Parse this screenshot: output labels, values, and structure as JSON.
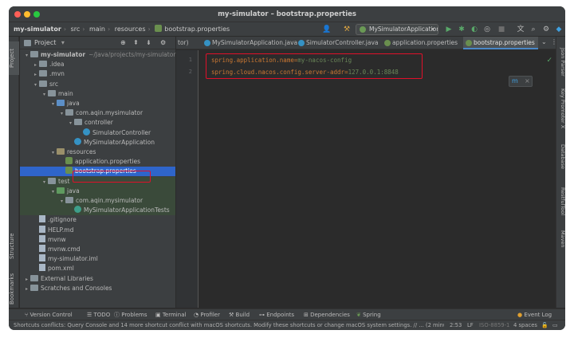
{
  "window": {
    "title": "my-simulator – bootstrap.properties"
  },
  "navbar": {
    "breadcrumbs": [
      "my-simulator",
      "src",
      "main",
      "resources",
      "bootstrap.properties"
    ],
    "run_config": "MySimulatorApplication"
  },
  "project_panel": {
    "title": "Project",
    "tree": [
      {
        "label": "my-simulator",
        "suffix": "~/Java/projects/my-simulator",
        "depth": 0,
        "expanded": true,
        "kind": "module"
      },
      {
        "label": ".idea",
        "depth": 1,
        "expanded": false,
        "kind": "folder"
      },
      {
        "label": ".mvn",
        "depth": 1,
        "expanded": false,
        "kind": "folder"
      },
      {
        "label": "src",
        "depth": 1,
        "expanded": true,
        "kind": "folder"
      },
      {
        "label": "main",
        "depth": 2,
        "expanded": true,
        "kind": "folder"
      },
      {
        "label": "java",
        "depth": 3,
        "expanded": true,
        "kind": "src"
      },
      {
        "label": "com.aqin.mysimulator",
        "depth": 4,
        "expanded": true,
        "kind": "package"
      },
      {
        "label": "controller",
        "depth": 5,
        "expanded": true,
        "kind": "package"
      },
      {
        "label": "SimulatorController",
        "depth": 6,
        "kind": "class"
      },
      {
        "label": "MySimulatorApplication",
        "depth": 5,
        "kind": "class"
      },
      {
        "label": "resources",
        "depth": 3,
        "expanded": true,
        "kind": "res"
      },
      {
        "label": "application.properties",
        "depth": 4,
        "kind": "props"
      },
      {
        "label": "bootstrap.properties",
        "depth": 4,
        "kind": "props",
        "selected": true
      },
      {
        "label": "test",
        "depth": 2,
        "expanded": true,
        "kind": "folder",
        "test": true
      },
      {
        "label": "java",
        "depth": 3,
        "expanded": true,
        "kind": "tst",
        "test": true
      },
      {
        "label": "com.aqin.mysimulator",
        "depth": 4,
        "expanded": true,
        "kind": "package",
        "test": true
      },
      {
        "label": "MySimulatorApplicationTests",
        "depth": 5,
        "kind": "class",
        "test": true
      },
      {
        "label": ".gitignore",
        "depth": 1,
        "kind": "file"
      },
      {
        "label": "HELP.md",
        "depth": 1,
        "kind": "file"
      },
      {
        "label": "mvnw",
        "depth": 1,
        "kind": "file"
      },
      {
        "label": "mvnw.cmd",
        "depth": 1,
        "kind": "file"
      },
      {
        "label": "my-simulator.iml",
        "depth": 1,
        "kind": "file"
      },
      {
        "label": "pom.xml",
        "depth": 1,
        "kind": "file"
      },
      {
        "label": "External Libraries",
        "depth": 0,
        "expanded": false,
        "kind": "lib"
      },
      {
        "label": "Scratches and Consoles",
        "depth": 0,
        "expanded": false,
        "kind": "lib"
      }
    ]
  },
  "editor": {
    "tabs": [
      {
        "label": "tor)",
        "active": false
      },
      {
        "label": "MySimulatorApplication.java",
        "active": false
      },
      {
        "label": "SimulatorController.java",
        "active": false
      },
      {
        "label": "application.properties",
        "active": false
      },
      {
        "label": "bootstrap.properties",
        "active": true
      }
    ],
    "lines": [
      {
        "num": "1",
        "key": "spring.application.name",
        "eq": "=",
        "value": "my-nacos-config"
      },
      {
        "num": "2",
        "key": "spring.cloud.nacos.config.server-addr",
        "eq": "=",
        "value": "127.0.0.1:8848"
      }
    ]
  },
  "left_stripe": {
    "top": [
      "Project"
    ],
    "bottom": [
      "Structure",
      "Bookmarks"
    ]
  },
  "right_stripe": [
    "Json Parser",
    "Key Promoter X",
    "Database",
    "RestfulTool",
    "Maven"
  ],
  "bottom_tools": [
    "Version Control",
    "TODO",
    "Problems",
    "Terminal",
    "Profiler",
    "Build",
    "Endpoints",
    "Dependencies",
    "Spring",
    "Event Log"
  ],
  "status_bar": {
    "message": "Shortcuts conflicts: Query Console and 14 more shortcut conflict with macOS shortcuts. Modify these shortcuts or change macOS system settings. // ... (2 minutes ago)",
    "position": "2:53",
    "line_sep": "LF",
    "encoding": "ISO-8859-1",
    "indent": "4 spaces"
  }
}
